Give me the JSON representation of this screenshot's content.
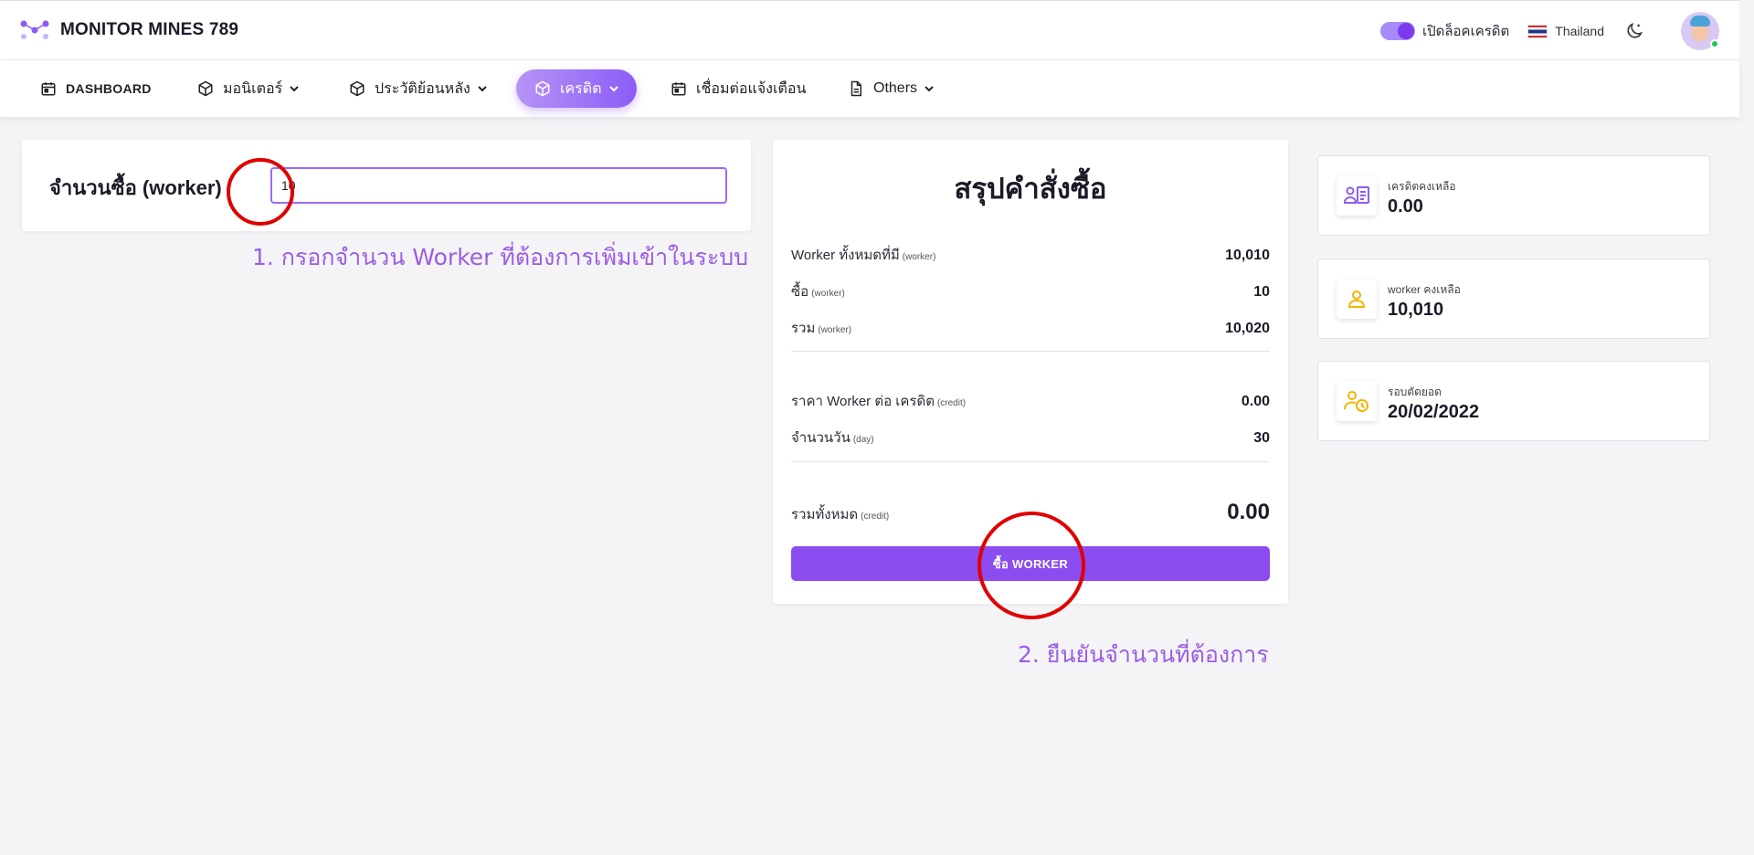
{
  "brand": {
    "name": "MONITOR MINES 789"
  },
  "topbar": {
    "toggle_label": "เปิดล็อคเครดิต",
    "language": "Thailand"
  },
  "nav": {
    "items": [
      {
        "label": "DASHBOARD",
        "icon": "calendar-icon"
      },
      {
        "label": "มอนิเตอร์",
        "icon": "cube-icon"
      },
      {
        "label": "ประวัติย้อนหลัง",
        "icon": "cube-icon"
      },
      {
        "label": "เครดิต",
        "icon": "cube-icon",
        "active": true
      },
      {
        "label": "เชื่อมต่อแจ้งเตือน",
        "icon": "calendar-icon"
      },
      {
        "label": "Others",
        "icon": "document-icon"
      }
    ]
  },
  "quantity": {
    "label": "จำนวนซื้อ (worker)",
    "value": "10"
  },
  "annotations": {
    "step1": "1. กรอกจำนวน Worker ที่ต้องการเพิ่มเข้าในระบบ",
    "step2": "2. ยืนยันจำนวนที่ต้องการ"
  },
  "summary": {
    "title": "สรุปคำสั่งซื้อ",
    "rows": [
      {
        "label": "Worker ทั้งหมดที่มี",
        "unit": "(worker)",
        "value": "10,010"
      },
      {
        "label": "ซื้อ",
        "unit": "(worker)",
        "value": "10"
      },
      {
        "label": "รวม",
        "unit": "(worker)",
        "value": "10,020"
      },
      {
        "label": "ราคา Worker ต่อ เครดิต",
        "unit": "(credit)",
        "value": "0.00"
      },
      {
        "label": "จำนวนวัน",
        "unit": "(day)",
        "value": "30"
      }
    ],
    "total": {
      "label": "รวมทั้งหมด",
      "unit": "(credit)",
      "value": "0.00"
    },
    "buy_button": "ซื้อ WORKER"
  },
  "stats": [
    {
      "label": "เครดิตคงเหลือ",
      "value": "0.00",
      "icon": "credit-card-user-icon",
      "color": "#8b5cf6"
    },
    {
      "label": "worker คงเหลือ",
      "value": "10,010",
      "icon": "user-icon",
      "color": "#f5b301"
    },
    {
      "label": "รอบตัดยอด",
      "value": "20/02/2022",
      "icon": "user-clock-icon",
      "color": "#f5b301"
    }
  ],
  "colors": {
    "accent": "#8b5cf6",
    "annotation": "#9b5de5",
    "highlight_circle": "#e00000"
  }
}
